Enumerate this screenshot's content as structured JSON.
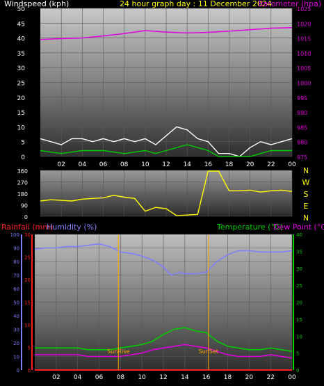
{
  "header": {
    "wind_title": "Windspeed (kph)",
    "date_title": "24 hour graph day : 11 December 2024",
    "baro_title": "Barometer (hpa)"
  },
  "colors": {
    "background": "#000000",
    "wind_gust": "#ffffff",
    "wind_speed": "#00cc00",
    "barometer": "#e000e0",
    "direction": "#ffff00",
    "rainfall": "#ff2020",
    "humidity": "#8080ff",
    "temperature": "#00cc00",
    "dew_point": "#e000e0",
    "sun_marker": "#ffa500",
    "title_yellow": "#ffff00"
  },
  "x_ticks": [
    "02",
    "04",
    "06",
    "08",
    "10",
    "12",
    "14",
    "16",
    "18",
    "20",
    "22",
    "00"
  ],
  "compass": [
    "N",
    "W",
    "S",
    "E",
    "N"
  ],
  "sun": {
    "rise_label": "SunRise",
    "rise_hour": 7.8,
    "set_label": "SunSet",
    "set_hour": 16.2
  },
  "chart_data": [
    {
      "type": "line",
      "title": "24 hour graph day : 11 December 2024",
      "x_unit": "hours",
      "xlim": [
        0,
        24
      ],
      "series": [
        {
          "name": "Windspeed (kph)",
          "axis": "left",
          "x": [
            0,
            2,
            4,
            6,
            8,
            10,
            11,
            12,
            13,
            14,
            15,
            16,
            17,
            18,
            19,
            20,
            21,
            22,
            23,
            24
          ],
          "values": [
            2,
            1,
            2,
            2,
            1,
            2,
            1,
            2,
            3,
            4,
            3,
            2,
            0,
            0,
            0,
            0,
            1,
            2,
            2,
            2
          ]
        },
        {
          "name": "Wind Gust (kph)",
          "axis": "left",
          "x": [
            0,
            1,
            2,
            3,
            4,
            5,
            6,
            7,
            8,
            9,
            10,
            11,
            12,
            13,
            14,
            15,
            16,
            17,
            18,
            19,
            20,
            21,
            22,
            23,
            24
          ],
          "values": [
            6,
            5,
            4,
            6,
            6,
            5,
            6,
            5,
            6,
            5,
            6,
            4,
            7,
            10,
            9,
            6,
            5,
            1,
            1,
            0,
            3,
            5,
            4,
            5,
            6
          ]
        },
        {
          "name": "Barometer (hpa)",
          "axis": "right",
          "x": [
            0,
            2,
            4,
            6,
            8,
            10,
            12,
            14,
            16,
            18,
            20,
            22,
            24
          ],
          "values": [
            1014.5,
            1014.8,
            1015.0,
            1015.7,
            1016.5,
            1017.5,
            1017.0,
            1016.7,
            1016.9,
            1017.3,
            1017.8,
            1018.3,
            1018.5
          ]
        }
      ],
      "y_left": {
        "label": "Windspeed (kph)",
        "lim": [
          0,
          50
        ],
        "ticks": [
          0,
          5,
          10,
          15,
          20,
          25,
          30,
          35,
          40,
          45,
          50
        ]
      },
      "y_right": {
        "label": "Barometer (hpa)",
        "lim": [
          975,
          1025
        ],
        "ticks": [
          975,
          980,
          985,
          990,
          995,
          1000,
          1005,
          1010,
          1015,
          1020,
          1025
        ]
      }
    },
    {
      "type": "line",
      "title": "",
      "x_unit": "hours",
      "xlim": [
        0,
        24
      ],
      "series": [
        {
          "name": "",
          "x": [
            0,
            1,
            2,
            3,
            4,
            5,
            6,
            7,
            8,
            9,
            10,
            11,
            12,
            13,
            14,
            15,
            16,
            17,
            18,
            19,
            20,
            21,
            22,
            23,
            24
          ],
          "values": [
            120,
            130,
            125,
            120,
            135,
            140,
            145,
            165,
            150,
            140,
            40,
            70,
            60,
            5,
            10,
            15,
            355,
            355,
            200,
            200,
            205,
            190,
            200,
            205,
            195
          ]
        }
      ],
      "y": {
        "lim": [
          0,
          360
        ],
        "ticks": [
          0,
          90,
          180,
          270,
          360
        ]
      }
    },
    {
      "type": "line",
      "title": "",
      "x_unit": "hours",
      "xlim": [
        0,
        24
      ],
      "series": [
        {
          "name": "Rainfall (mm)",
          "axis": "rain",
          "x": [
            0,
            6,
            12,
            18,
            24
          ],
          "values": [
            0,
            0,
            0,
            0,
            0
          ]
        },
        {
          "name": "Humidity (%)",
          "axis": "humidity",
          "x": [
            0,
            1,
            2,
            3,
            4,
            5,
            6,
            7,
            8,
            9,
            10,
            11,
            12,
            12.7,
            13.5,
            14,
            15,
            16,
            17,
            18,
            19,
            20,
            21,
            22,
            23,
            24
          ],
          "values": [
            89,
            90,
            90,
            91,
            91,
            92,
            93,
            91,
            87,
            86,
            84,
            81,
            76,
            70,
            72,
            71,
            71,
            72,
            80,
            85,
            88,
            88,
            87,
            87,
            87,
            88
          ]
        },
        {
          "name": "Temperature (°C)",
          "axis": "temperature",
          "x": [
            0,
            1,
            2,
            3,
            4,
            5,
            6,
            7,
            8,
            9,
            10,
            11,
            12,
            13,
            14,
            15,
            16,
            17,
            18,
            19,
            20,
            21,
            22,
            23,
            24
          ],
          "values": [
            6.5,
            6.5,
            6.5,
            6.5,
            6.5,
            6.0,
            6.0,
            6.0,
            6.5,
            7.0,
            7.5,
            8.5,
            10.5,
            12.0,
            12.5,
            11.5,
            11.0,
            8.5,
            7.0,
            6.5,
            6.0,
            6.0,
            6.5,
            6.0,
            5.5
          ]
        },
        {
          "name": "Dew Point (°C)",
          "axis": "temperature",
          "x": [
            0,
            1,
            2,
            3,
            4,
            5,
            6,
            7,
            8,
            9,
            10,
            11,
            12,
            13,
            14,
            15,
            16,
            17,
            18,
            19,
            20,
            21,
            22,
            23,
            24
          ],
          "values": [
            4.5,
            4.5,
            4.5,
            4.5,
            4.5,
            4.0,
            4.0,
            4.0,
            4.0,
            4.5,
            5.0,
            6.0,
            6.5,
            7.0,
            7.5,
            7.0,
            6.5,
            5.5,
            4.5,
            4.0,
            4.0,
            4.0,
            4.5,
            4.0,
            3.5
          ]
        }
      ],
      "y_rain": {
        "label": "Rainfall (mm)",
        "lim": [
          0,
          30
        ],
        "ticks": [
          0,
          5,
          10,
          15,
          20,
          25,
          30
        ]
      },
      "y_humidity": {
        "label": "Humidity (%)",
        "lim": [
          0,
          100
        ],
        "ticks": [
          0,
          10,
          20,
          30,
          40,
          50,
          60,
          70,
          80,
          90,
          100
        ]
      },
      "y_temperature": {
        "label": "Temperature (°C)",
        "label2": "Dew Point (°C)",
        "lim": [
          0,
          40
        ],
        "ticks": [
          0,
          5,
          10,
          15,
          20,
          25,
          30,
          35,
          40
        ]
      }
    }
  ]
}
